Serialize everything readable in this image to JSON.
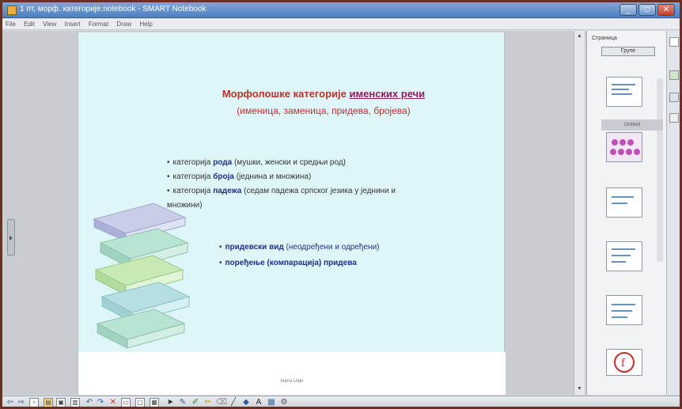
{
  "window": {
    "title": "1 пт, морф. категорије.notebook - SMART Notebook"
  },
  "menubar": {
    "items": [
      "File",
      "Edit",
      "View",
      "Insert",
      "Format",
      "Draw",
      "Help"
    ]
  },
  "slide": {
    "title_prefix": "Морфолошке категорије ",
    "title_highlight": "именских речи",
    "subtitle": "(именица, заменица, придева, бројева)",
    "bullets": [
      {
        "prefix": "категорија ",
        "bold": "рода",
        "rest": " (мушки, женски и средњи род)"
      },
      {
        "prefix": "категорија ",
        "bold": "броја",
        "rest": " (једнина и множина)"
      },
      {
        "prefix": "категорија ",
        "bold": "падежа",
        "rest": " (седам падежа српског језика у једнини и"
      }
    ],
    "bullet3_continuation": "множини)",
    "adjective_bullets": [
      {
        "bold": "придевски вид",
        "rest": " (неодређени и одређени)"
      },
      {
        "bold": "поређење (компарација) придева",
        "rest": ""
      }
    ],
    "footer": "Ivana Lilan"
  },
  "sidepanel": {
    "header": "Страница",
    "button": "Групе",
    "selected_label": "Untitled"
  },
  "colors": {
    "slide_background": "#dff6f8",
    "title_color": "#b8322a",
    "highlight_color": "#8f1c59",
    "bullet_color": "#1f2f8a",
    "book_stack": "#a8d8c4"
  },
  "toolbar": {
    "icons": [
      "back-icon",
      "forward-icon",
      "blank-page-icon",
      "open-icon",
      "save-icon",
      "paste-icon",
      "undo-icon",
      "redo-icon",
      "delete-icon",
      "screen-shade-icon",
      "full-screen-icon",
      "table-icon",
      "select-icon",
      "pen-icon",
      "creative-pen-icon",
      "highlighter-icon",
      "eraser-icon",
      "line-icon",
      "shape-icon",
      "text-icon",
      "fill-icon",
      "properties-icon"
    ]
  }
}
